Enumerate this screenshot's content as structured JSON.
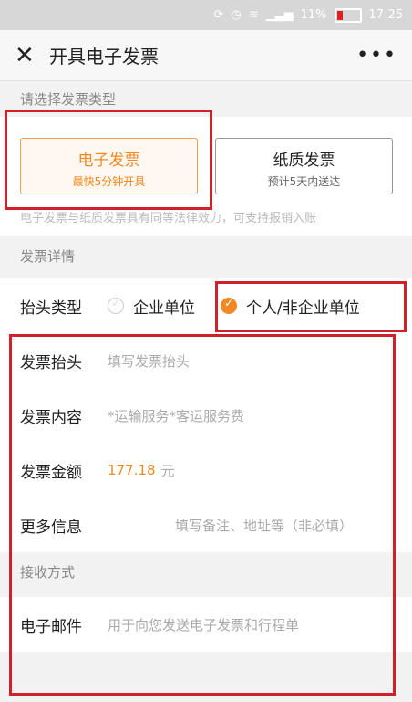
{
  "status": {
    "battery": "11%",
    "time": "17:25"
  },
  "header": {
    "title": "开具电子发票",
    "more": "•••"
  },
  "invoice_type": {
    "section_title": "请选择发票类型",
    "options": [
      {
        "title": "电子发票",
        "subtitle": "最快5分钟开具",
        "active": true
      },
      {
        "title": "纸质发票",
        "subtitle": "预计5天内送达",
        "active": false
      }
    ],
    "note": "电子发票与纸质发票具有同等法律效力，可支持报销入账"
  },
  "details": {
    "section_title": "发票详情",
    "title_type": {
      "label": "抬头类型",
      "options": [
        "企业单位",
        "个人/非企业单位"
      ],
      "selected": "个人/非企业单位"
    },
    "invoice_title": {
      "label": "发票抬头",
      "placeholder": "填写发票抬头"
    },
    "invoice_content": {
      "label": "发票内容",
      "value": "*运输服务*客运服务费"
    },
    "invoice_amount": {
      "label": "发票金额",
      "value": "177.18",
      "unit": "元"
    },
    "more_info": {
      "label": "更多信息",
      "placeholder": "填写备注、地址等（非必填）"
    }
  },
  "receive": {
    "section_title": "接收方式",
    "email": {
      "label": "电子邮件",
      "placeholder": "用于向您发送电子发票和行程单"
    }
  },
  "colors": {
    "accent": "#f08a24",
    "highlight": "#d0202a"
  }
}
